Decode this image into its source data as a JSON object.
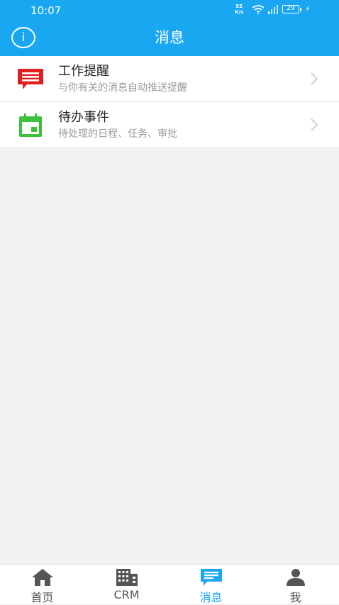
{
  "status_bar": {
    "time": "10:07",
    "net_speed_value": "55",
    "net_speed_unit": "K/s",
    "battery": "29"
  },
  "header": {
    "info_icon_glyph": "i",
    "title": "消息"
  },
  "messages": [
    {
      "icon": "message-icon",
      "title": "工作提醒",
      "subtitle": "与你有关的消息自动推送提醒",
      "icon_color": "#e02020"
    },
    {
      "icon": "calendar-icon",
      "title": "待办事件",
      "subtitle": "待处理的日程、任务、审批",
      "icon_color": "#3cc23c"
    }
  ],
  "tabs": [
    {
      "icon": "home-icon",
      "label": "首页"
    },
    {
      "icon": "building-icon",
      "label": "CRM"
    },
    {
      "icon": "chat-icon",
      "label": "消息",
      "active": true
    },
    {
      "icon": "person-icon",
      "label": "我"
    }
  ],
  "colors": {
    "accent": "#1aa7f2",
    "background": "#f2f2f2",
    "tab_inactive": "#555555"
  }
}
